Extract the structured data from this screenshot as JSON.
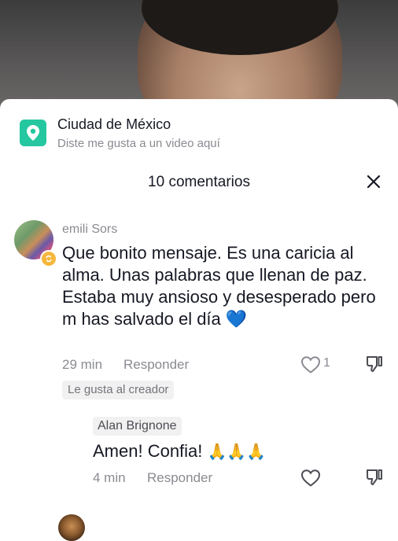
{
  "location": {
    "title": "Ciudad de México",
    "subtitle": "Diste me gusta a un video aquí",
    "icon": "location-pin-icon",
    "color": "#24c7a0"
  },
  "comments_header": {
    "title": "10 comentarios"
  },
  "comments": [
    {
      "author": "emili Sors",
      "text": "Que bonito mensaje. Es una caricia al alma. Unas palabras que llenan de paz. Estaba muy ansioso y desesperado pero m has salvado el día",
      "emoji": "💙",
      "time": "29 min",
      "reply_label": "Responder",
      "likes": "1",
      "creator_badge": "Le gusta al creador"
    },
    {
      "author": "Alan Brignone",
      "text": "Amen! Confia!",
      "emoji": "🙏🙏🙏",
      "time": "4 min",
      "reply_label": "Responder"
    }
  ]
}
